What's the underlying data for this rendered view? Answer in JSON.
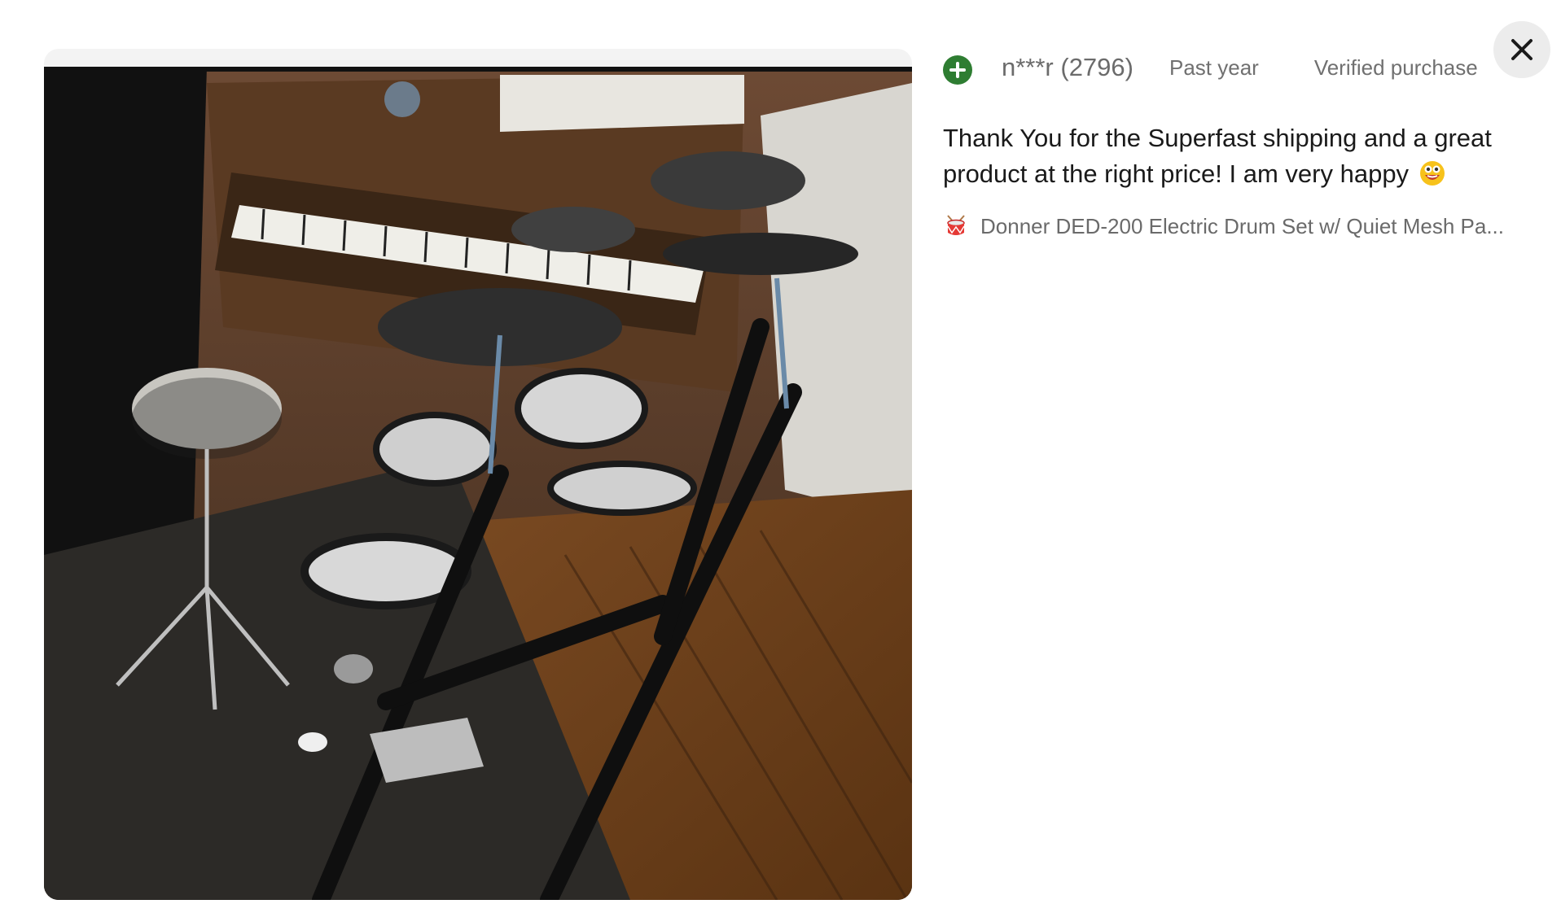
{
  "review": {
    "reviewer": "n***r (2796)",
    "period": "Past year",
    "verified": "Verified purchase",
    "text": "Thank You for the Superfast shipping and a great product at the right price! I am very happy",
    "product": "Donner DED-200 Electric Drum Set w/ Quiet Mesh Pa..."
  },
  "icons": {
    "reviewer_badge": "plus-circle-icon",
    "close": "close-icon",
    "emoji": "grinning-face-icon",
    "product": "drum-icon"
  },
  "colors": {
    "badge_green": "#2e7d32",
    "close_bg": "#ececec"
  }
}
